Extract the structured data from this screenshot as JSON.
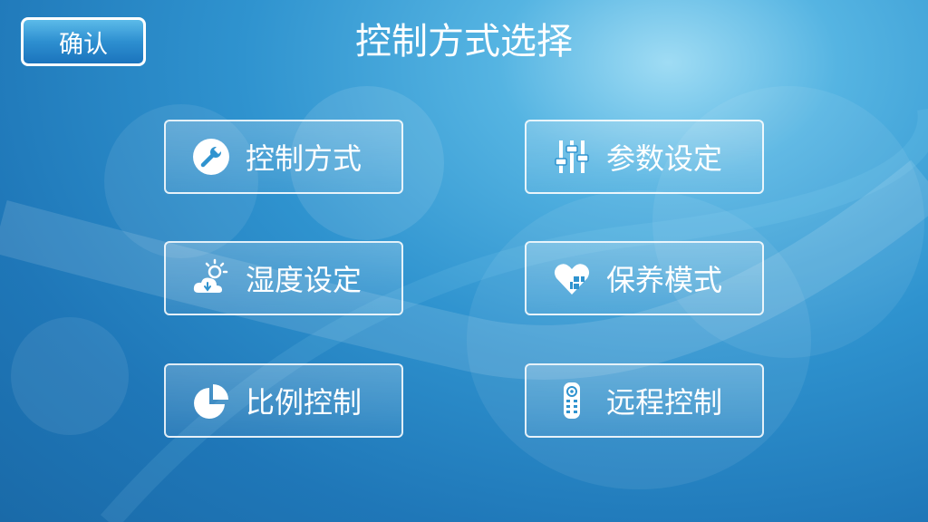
{
  "header": {
    "confirm_label": "确认",
    "title": "控制方式选择"
  },
  "menu": [
    {
      "label": "控制方式",
      "icon": "wrench-icon"
    },
    {
      "label": "参数设定",
      "icon": "sliders-icon"
    },
    {
      "label": "湿度设定",
      "icon": "weather-humidity-icon"
    },
    {
      "label": "保养模式",
      "icon": "heart-building-icon"
    },
    {
      "label": "比例控制",
      "icon": "pie-chart-icon"
    },
    {
      "label": "远程控制",
      "icon": "remote-control-icon"
    }
  ],
  "colors": {
    "background": "#2f93cf",
    "text": "#ffffff",
    "button_border": "#ffffff"
  }
}
